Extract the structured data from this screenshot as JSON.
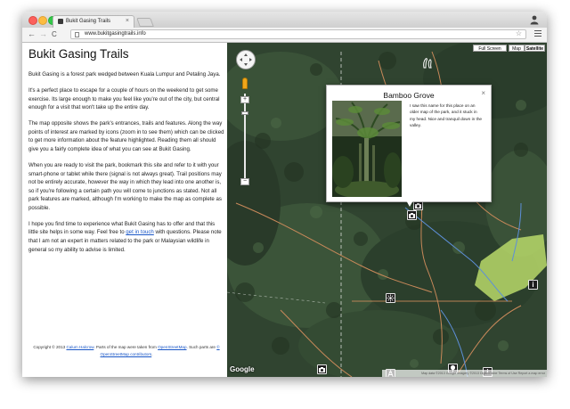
{
  "browser": {
    "tab_title": "Bukit Gasing Trails",
    "tab_close": "×",
    "url": "www.bukitgasingtrails.info",
    "back": "←",
    "forward": "→",
    "reload": "C",
    "star": "☆"
  },
  "sidebar": {
    "title": "Bukit Gasing Trails",
    "p1": "Bukit Gasing is a forest park wedged between Kuala Lumpur and Petaling Jaya.",
    "p2": "It's a perfect place to escape for a couple of hours on the weekend to get some exercise. Its large enough to make you feel like you're out of the city, but central enough for a visit that won't take up the entire day.",
    "p3": "The map opposite shows the park's entrances, trails and features. Along the way points of interest are marked by icons (zoom in to see them) which can be clicked to get more information about the feature highlighted. Reading them all should give you a fairly complete idea of what you can see at Bukit Gasing.",
    "p4": "When you are ready to visit the park, bookmark this site and refer to it with your smart-phone or tablet while there (signal is not always great). Trail positions may not be entirely accurate, however the way in which they lead into one another is, so if you're following a certain path you will come to junctions as stated. Not all park features are marked, although I'm working to make the map as complete as possible.",
    "p5_before": "I hope you find time to experience what Bukit Gasing has to offer and that this little site helps in some way. Feel free to ",
    "p5_link": "get in touch",
    "p5_after": " with questions. Please note that I am not an expert in matters related to the park or Malaysian wildlife in general so my ability to advise is limited.",
    "footer": {
      "t1": "Copyright © 2013 ",
      "author": "Calum Halcrow",
      "t2": ". Parts of the map were taken from ",
      "osm1": "OpenStreetMap",
      "t3": ". Such parts are ",
      "osm2": "© OpenStreetMap contributors",
      "t4": "."
    }
  },
  "map": {
    "fullscreen": "Full Screen",
    "map_type": "Map",
    "satellite": "Satellite",
    "zoom_in": "+",
    "zoom_out": "−",
    "google": "Google",
    "attribution": "Map data ©2013 Google Imagery ©2013 DigitalGlobe   Terms of Use   Report a map error",
    "popup": {
      "title": "Bamboo Grove",
      "close": "×",
      "text": "I saw this name for this place on an older map of the park, and it stuck in my head. Nice and tranquil down in the valley."
    },
    "marker_info_label": "i"
  },
  "colors": {
    "link": "#1a57c7",
    "canopy_dark": "#314532",
    "highlight_area": "#b8d96a",
    "trail": "#c9895a",
    "stream": "#5d8fd8"
  }
}
